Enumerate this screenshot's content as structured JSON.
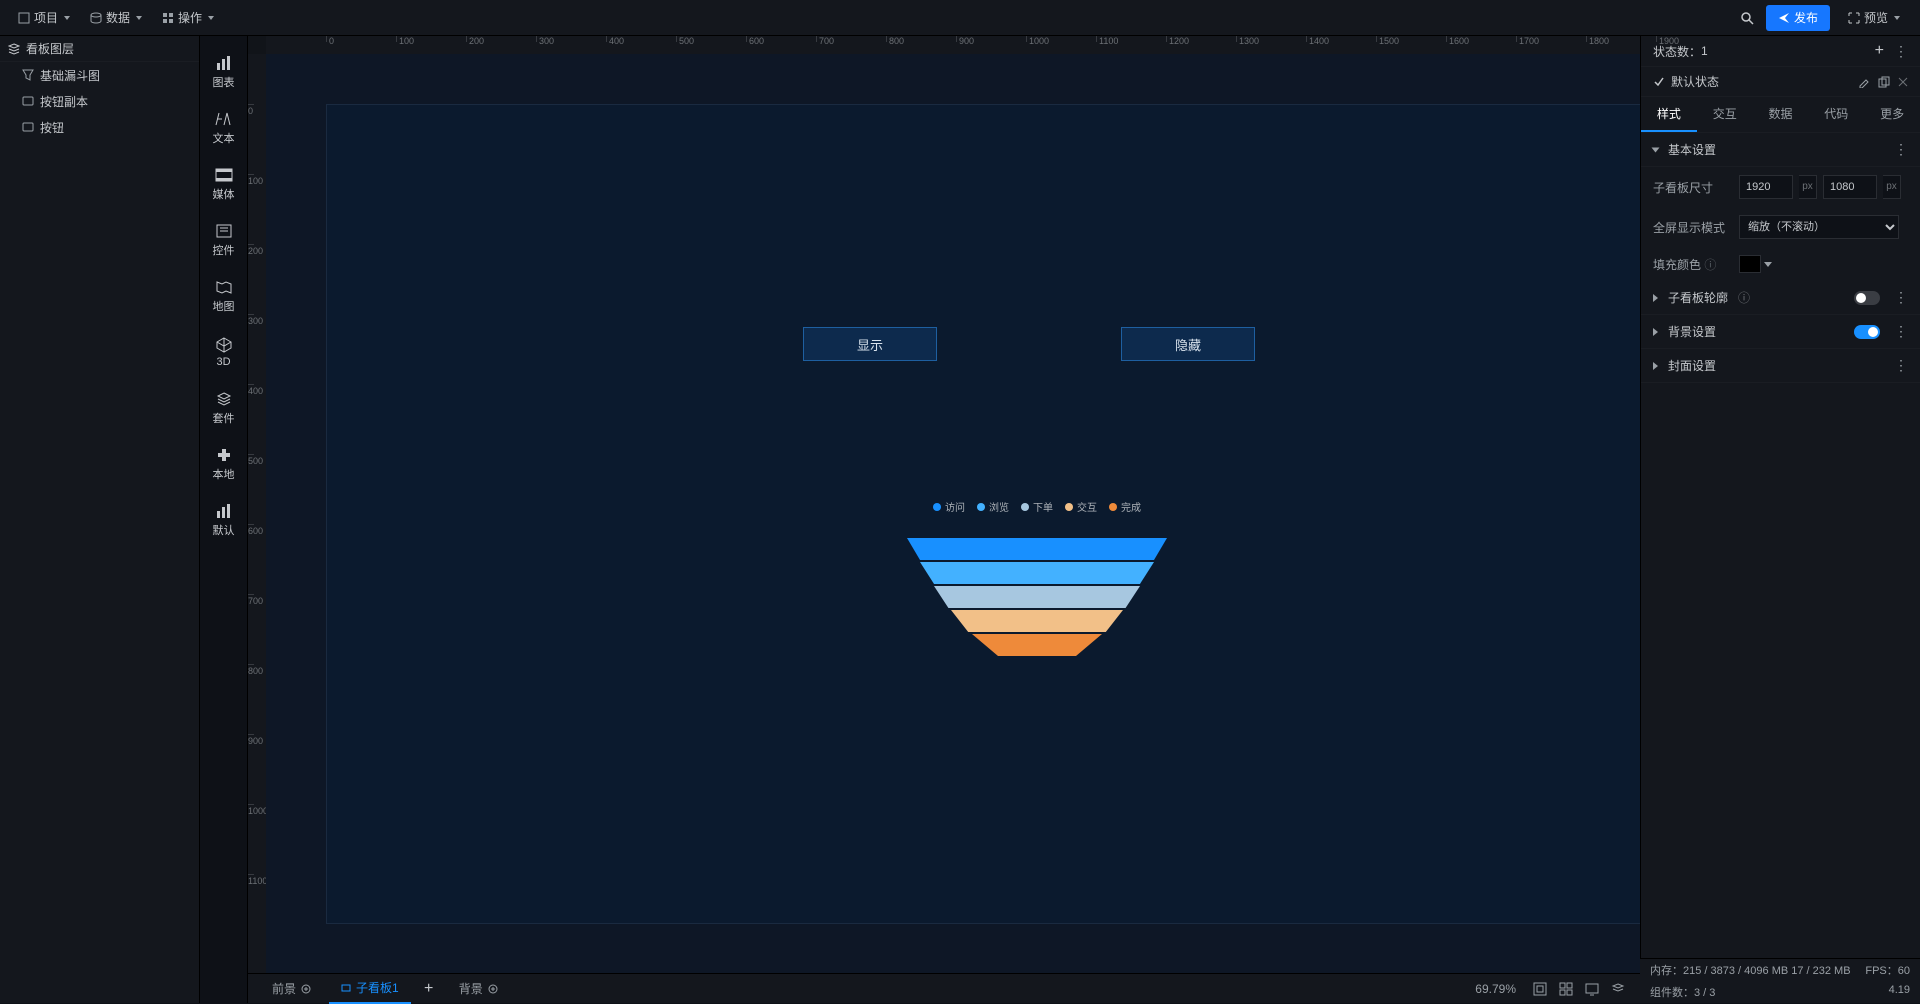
{
  "topMenu": {
    "project": "项目",
    "data": "数据",
    "ops": "操作",
    "publish": "发布",
    "preview": "预览"
  },
  "leftPanel": {
    "title": "看板图层",
    "items": [
      {
        "icon": "funnel",
        "label": "基础漏斗图"
      },
      {
        "icon": "btn",
        "label": "按钮副本"
      },
      {
        "icon": "btn",
        "label": "按钮"
      }
    ]
  },
  "rail": [
    {
      "key": "chart",
      "label": "图表"
    },
    {
      "key": "text",
      "label": "文本"
    },
    {
      "key": "media",
      "label": "媒体"
    },
    {
      "key": "ctrl",
      "label": "控件"
    },
    {
      "key": "map",
      "label": "地图"
    },
    {
      "key": "3d",
      "label": "3D"
    },
    {
      "key": "kit",
      "label": "套件"
    },
    {
      "key": "local",
      "label": "本地"
    },
    {
      "key": "default",
      "label": "默认"
    }
  ],
  "canvas": {
    "btn_show": "显示",
    "btn_hide": "隐藏"
  },
  "chart_data": {
    "type": "funnel",
    "title": "",
    "categories": [
      "访问",
      "浏览",
      "下单",
      "交互",
      "完成"
    ],
    "values": [
      100,
      90,
      79,
      66,
      50
    ],
    "colors": [
      "#1890ff",
      "#43b1ff",
      "#a7c7e0",
      "#f2c088",
      "#ee8a3a"
    ],
    "legend_position": "top"
  },
  "bottomTabs": {
    "fore": "前景",
    "sub": "子看板1",
    "back": "背景",
    "add": "+",
    "zoom": "69.79%"
  },
  "right": {
    "stateCount_lbl": "状态数：",
    "stateCount_val": "1",
    "defaultState": "默认状态",
    "tabs": [
      "样式",
      "交互",
      "数据",
      "代码",
      "更多"
    ],
    "basicSettings": "基本设置",
    "boardSize_lbl": "子看板尺寸",
    "w": "1920",
    "h": "1080",
    "unit": "px",
    "fullscreen_lbl": "全屏显示模式",
    "fullscreen_val": "缩放（不滚动）",
    "fill_lbl": "填充颜色",
    "outline_lbl": "子看板轮廓",
    "bg_lbl": "背景设置",
    "cover_lbl": "封面设置"
  },
  "footer": {
    "mem_lbl": "内存：",
    "mem_val": "215 / 3873 / 4096 MB  17 / 232 MB",
    "fps_lbl": "FPS：",
    "fps_val": "60",
    "comp_lbl": "组件数：",
    "comp_val": "3 / 3",
    "ver": "4.19"
  }
}
